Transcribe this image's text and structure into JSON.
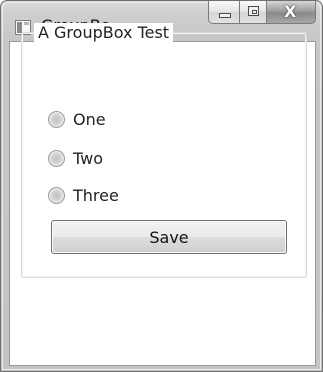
{
  "window": {
    "title": "GroupBo...",
    "icon": "application-icon"
  },
  "caption_buttons": {
    "minimize": "minimize-icon",
    "maximize": "maximize-icon",
    "close": "close-icon",
    "close_glyph": "X"
  },
  "groupbox": {
    "header": "A GroupBox Test",
    "options": [
      {
        "label": "One",
        "checked": false
      },
      {
        "label": "Two",
        "checked": false
      },
      {
        "label": "Three",
        "checked": false
      }
    ],
    "save_label": "Save"
  }
}
